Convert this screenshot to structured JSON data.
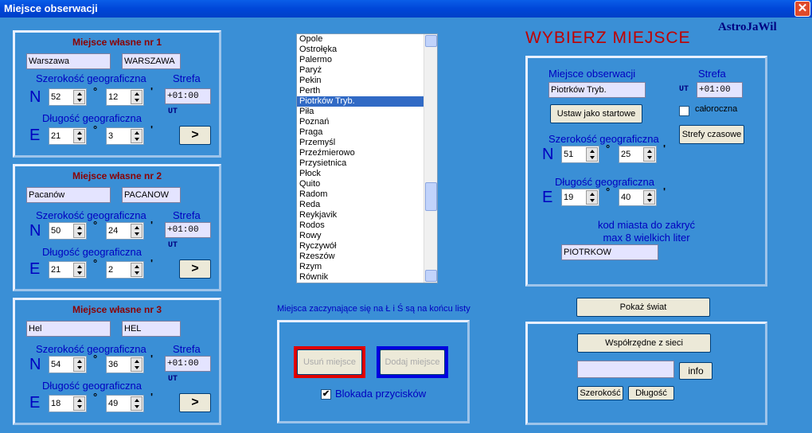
{
  "window": {
    "title": "Miejsce obserwacji",
    "close": "✕"
  },
  "app_name": "AstroJaWil",
  "heading": "WYBIERZ  MIEJSCE",
  "common": {
    "lat_label": "Szerokość geograficzna",
    "lon_label": "Długość geograficzna",
    "zone_label": "Strefa",
    "ut": "UT",
    "N": "N",
    "E": "E",
    "deg": "°",
    "min": "'",
    "go": ">"
  },
  "places": [
    {
      "title": "Miejsce własne nr 1",
      "name": "Warszawa",
      "code": "WARSZAWA",
      "lat_deg": "52",
      "lat_min": "12",
      "lon_deg": "21",
      "lon_min": "3",
      "zone": "+01:00"
    },
    {
      "title": "Miejsce własne nr 2",
      "name": "Pacanów",
      "code": "PACANOW",
      "lat_deg": "50",
      "lat_min": "24",
      "lon_deg": "21",
      "lon_min": "2",
      "zone": "+01:00"
    },
    {
      "title": "Miejsce własne nr 3",
      "name": "Hel",
      "code": "HEL",
      "lat_deg": "54",
      "lat_min": "36",
      "lon_deg": "18",
      "lon_min": "49",
      "zone": "+01:00"
    }
  ],
  "city_list": [
    "Opole",
    "Ostrołęka",
    "Palermo",
    "Paryż",
    "Pekin",
    "Perth",
    "Piotrków Tryb.",
    "Piła",
    "Poznań",
    "Praga",
    "Przemyśl",
    "Przeźmierowo",
    "Przysietnica",
    "Płock",
    "Quito",
    "Radom",
    "Reda",
    "Reykjavik",
    "Rodos",
    "Rowy",
    "Ryczywół",
    "Rzeszów",
    "Rzym",
    "Równik"
  ],
  "selected_city": "Piotrków Tryb.",
  "list_note": "Miejsca zaczynające się na  Ł i Ś  są na końcu listy",
  "buttons": {
    "remove": "Usuń miejsce",
    "add": "Dodaj miejsce",
    "lock": "Blokada przycisków"
  },
  "obs": {
    "title": "Miejsce obserwacji",
    "zone_title": "Strefa",
    "name": "Piotrków Tryb.",
    "zone": "+01:00",
    "set_start": "Ustaw jako startowe",
    "year_round": "całoroczna",
    "time_zones": "Strefy czasowe",
    "lat_deg": "51",
    "lat_min": "25",
    "lon_deg": "19",
    "lon_min": "40",
    "code_label1": "kod miasta do zakryć",
    "code_label2": "max 8 wielkich liter",
    "code": "PIOTRKOW"
  },
  "world": "Pokaż świat",
  "net": {
    "coords": "Współrzędne z sieci",
    "input": "",
    "info": "info",
    "lat": "Szerokość",
    "lon": "Długość"
  }
}
